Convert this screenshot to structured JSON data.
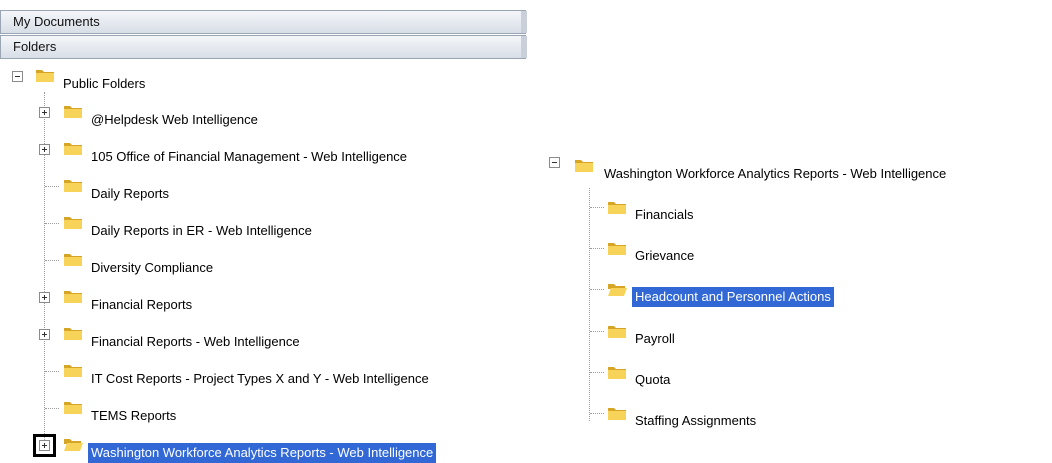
{
  "tabs": {
    "my_documents": "My Documents",
    "folders": "Folders"
  },
  "left_tree": {
    "root": "Public Folders",
    "items": [
      {
        "label": "@Helpdesk Web Intelligence",
        "expandable": true
      },
      {
        "label": "105 Office of Financial Management - Web Intelligence",
        "expandable": true
      },
      {
        "label": "Daily Reports",
        "expandable": false
      },
      {
        "label": "Daily Reports in ER - Web Intelligence",
        "expandable": false
      },
      {
        "label": "Diversity Compliance",
        "expandable": false
      },
      {
        "label": "Financial Reports",
        "expandable": true
      },
      {
        "label": "Financial Reports - Web Intelligence",
        "expandable": true
      },
      {
        "label": "IT Cost Reports - Project Types X and Y - Web Intelligence",
        "expandable": false
      },
      {
        "label": "TEMS Reports",
        "expandable": false
      },
      {
        "label": "Washington Workforce Analytics Reports - Web Intelligence",
        "expandable": true,
        "selected": true
      }
    ]
  },
  "right_tree": {
    "root": "Washington Workforce Analytics Reports - Web Intelligence",
    "items": [
      {
        "label": "Financials"
      },
      {
        "label": "Grievance"
      },
      {
        "label": "Headcount and Personnel Actions",
        "selected": true
      },
      {
        "label": "Payroll"
      },
      {
        "label": "Quota"
      },
      {
        "label": "Staffing Assignments"
      }
    ]
  },
  "colors": {
    "selection": "#3168d5",
    "folder_fill": "#f7d35a",
    "folder_dark": "#d7a525"
  }
}
